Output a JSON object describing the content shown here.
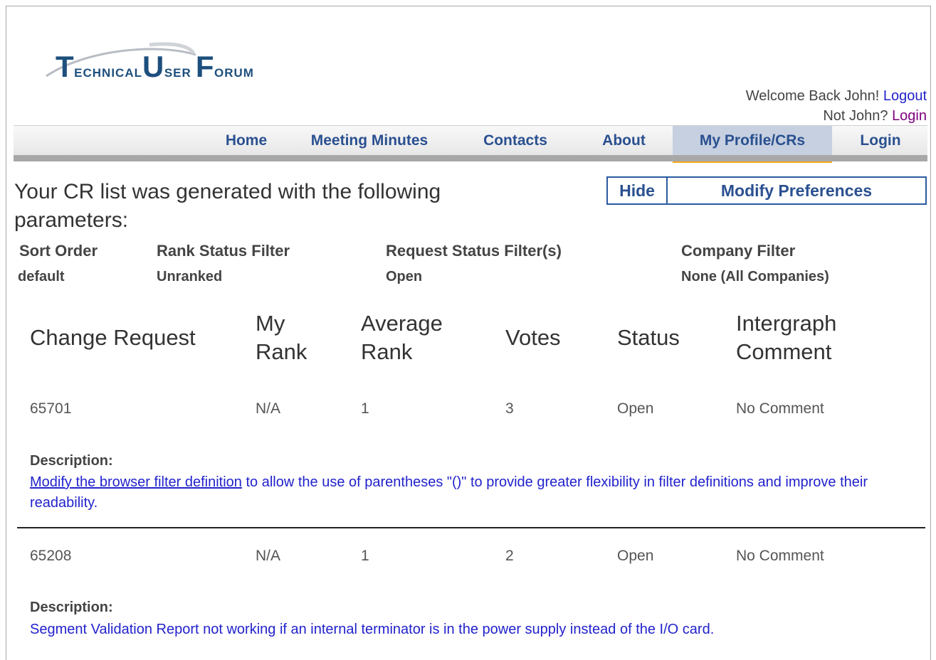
{
  "logo": {
    "t": "T",
    "echnical": "ECHNICAL",
    "u": "U",
    "ser": "SER",
    "f": "F",
    "orum": "ORUM"
  },
  "welcome": {
    "greeting": "Welcome Back John!",
    "logout": "Logout",
    "not_user": "Not John?",
    "login": "Login"
  },
  "nav": {
    "items": [
      {
        "label": "Home"
      },
      {
        "label": "Meeting Minutes"
      },
      {
        "label": "Contacts"
      },
      {
        "label": "About"
      },
      {
        "label": "My Profile/CRs"
      },
      {
        "label": "Login"
      }
    ],
    "active_color": "#f4a81c"
  },
  "params": {
    "title": "Your CR list was generated with the following parameters:",
    "hide": "Hide",
    "modify": "Modify Preferences",
    "labels": [
      "Sort Order",
      "Rank Status Filter",
      "Request Status Filter(s)",
      "Company Filter"
    ],
    "values": [
      "default",
      "Unranked",
      "Open",
      "None (All Companies)"
    ]
  },
  "table": {
    "headers": {
      "change_request": "Change Request",
      "my_rank_1": "My",
      "my_rank_2": "Rank",
      "avg_rank_1": "Average",
      "avg_rank_2": "Rank",
      "votes": "Votes",
      "status": "Status",
      "comment_1": "Intergraph",
      "comment_2": "Comment"
    },
    "rows": [
      {
        "cr": "65701",
        "my_rank": "N/A",
        "avg_rank": "1",
        "votes": "3",
        "status": "Open",
        "comment": "No Comment",
        "desc_label": "Description:",
        "desc_link": "Modify the browser filter definition",
        "desc_rest": " to allow the use of parentheses \"()\" to provide greater flexibility in filter definitions and improve their readability."
      },
      {
        "cr": "65208",
        "my_rank": "N/A",
        "avg_rank": "1",
        "votes": "2",
        "status": "Open",
        "comment": "No Comment",
        "desc_label": "Description:",
        "desc_text": "Segment Validation Report not working if an internal terminator is in the power supply instead of the I/O card."
      }
    ]
  }
}
